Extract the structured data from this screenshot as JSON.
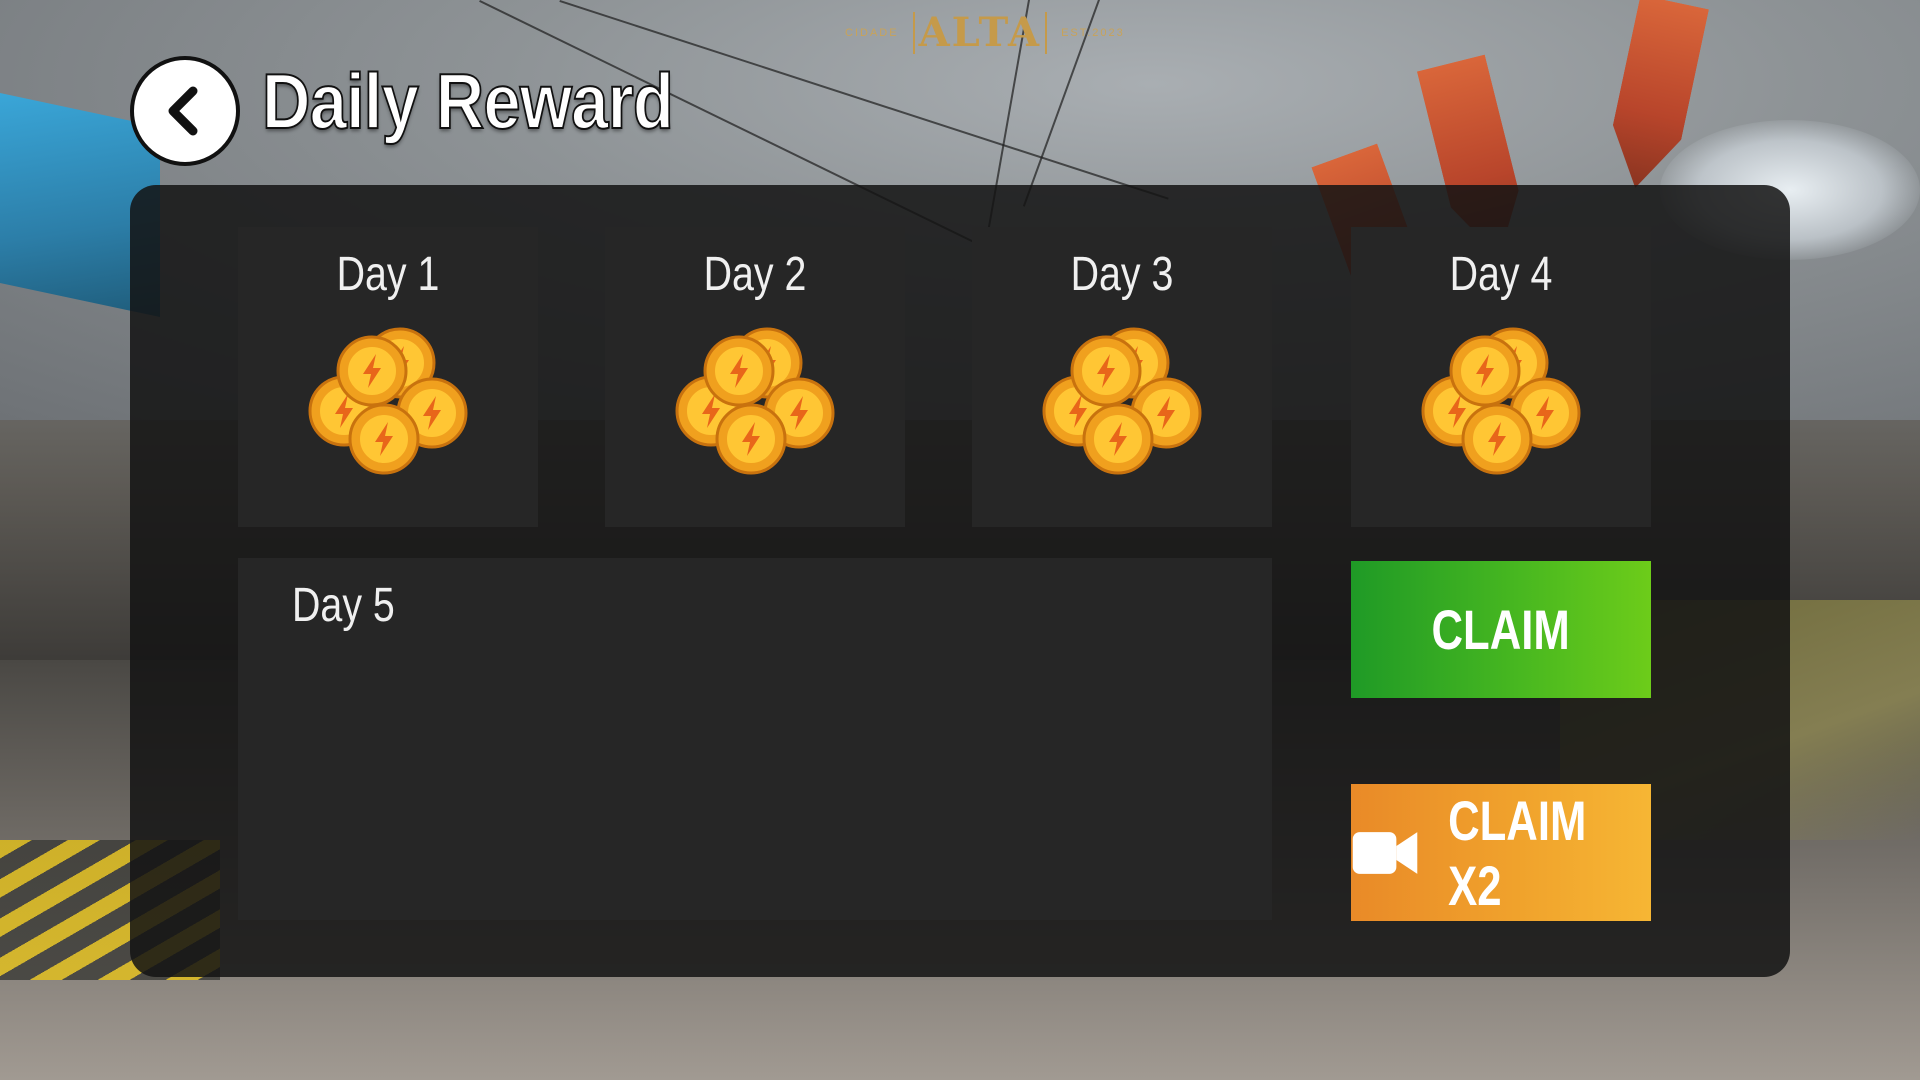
{
  "header": {
    "title": "Daily Reward",
    "back_icon": "chevron-left-icon"
  },
  "branding": {
    "left": "CIDADE",
    "mark": "ALTA",
    "right": "EST.2023"
  },
  "days": [
    {
      "label": "Day 1",
      "reward_icon": "coin-stack-icon"
    },
    {
      "label": "Day 2",
      "reward_icon": "coin-stack-icon"
    },
    {
      "label": "Day 3",
      "reward_icon": "coin-stack-icon"
    },
    {
      "label": "Day 4",
      "reward_icon": "coin-stack-icon"
    },
    {
      "label": "Day 5",
      "reward_icon": ""
    }
  ],
  "actions": {
    "claim_label": "CLAIM",
    "claim_x2_label": "CLAIM X2",
    "claim_x2_icon": "video-camera-icon"
  },
  "colors": {
    "claim": "#47b720",
    "claim_x2": "#f0a22c",
    "panel": "#141414",
    "card": "#262626",
    "coin": "#f5a623"
  }
}
